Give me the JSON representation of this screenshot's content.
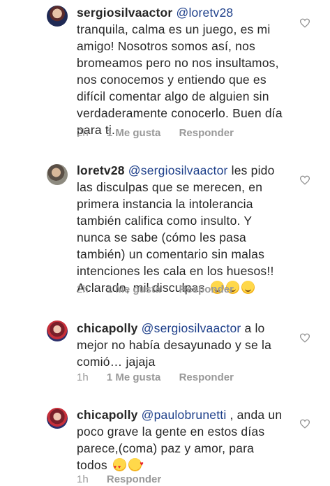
{
  "comments": [
    {
      "username": "sergiosilvaactor",
      "mention": "@loretv28",
      "text": " tranquila, calma es un juego, es mi amigo! Nosotros somos así, nos bromeamos pero no nos insultamos, nos conocemos y entiendo que es difícil comentar algo de alguien sin verdaderamente conocerlo. Buen día para ti.",
      "time": "2h",
      "likes": "1 Me gusta",
      "reply": "Responder"
    },
    {
      "username": "loretv28",
      "mention": "@sergiosilvaactor",
      "text": " les pido las disculpas que se merecen, en primera instancia la intolerancia también califica como insulto. Y nunca se sabe (cómo les pasa también) un comentario sin malas intenciones les cala en los huesos!! Aclarado, mil disculpas",
      "emojis": [
        "smiling-face-emoji",
        "smiling-face-emoji",
        "smiling-face-emoji"
      ],
      "time": "2h",
      "likes": "1 Me gusta",
      "reply": "Responder"
    },
    {
      "username": "chicapolly",
      "mention": "@sergiosilvaactor",
      "text": " a lo mejor no había desayunado y se la comió… jajaja",
      "time": "1h",
      "likes": "1 Me gusta",
      "reply": "Responder"
    },
    {
      "username": "chicapolly",
      "mention": "@paulobrunetti",
      "text": " , anda un poco grave la gente en estos días parece,(coma) paz y amor, para todos",
      "emojis": [
        "heart-eyes-emoji",
        "kissing-heart-emoji"
      ],
      "time": "1h",
      "reply": "Responder"
    }
  ],
  "icons": {
    "like": "heart-outline-icon"
  },
  "colors": {
    "mention": "#1d3f8a",
    "meta": "#999999",
    "text": "#262626"
  }
}
